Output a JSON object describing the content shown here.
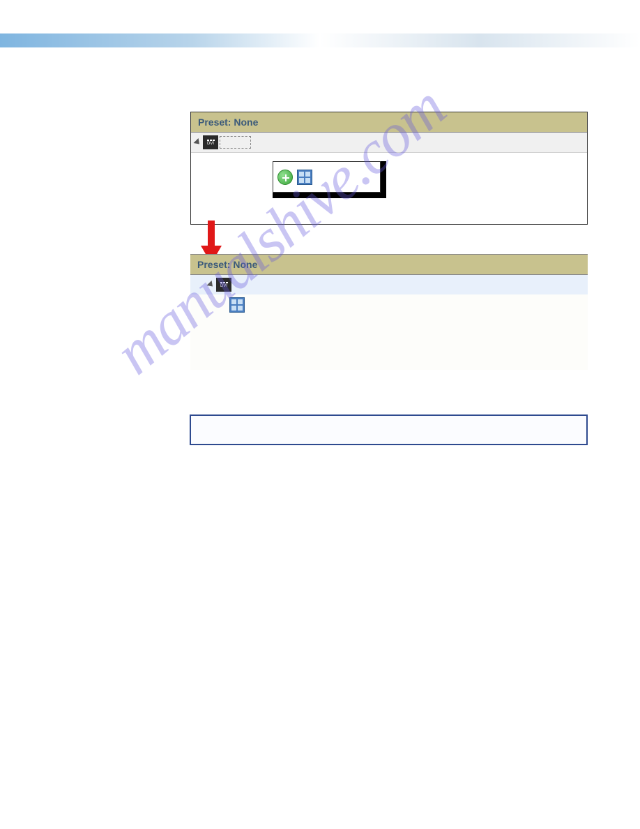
{
  "panel1": {
    "header": "Preset: None",
    "node_label": "DVI"
  },
  "panel2": {
    "header": "Preset: None",
    "node_label": "DVI"
  },
  "watermark_text": "manualshive.com"
}
